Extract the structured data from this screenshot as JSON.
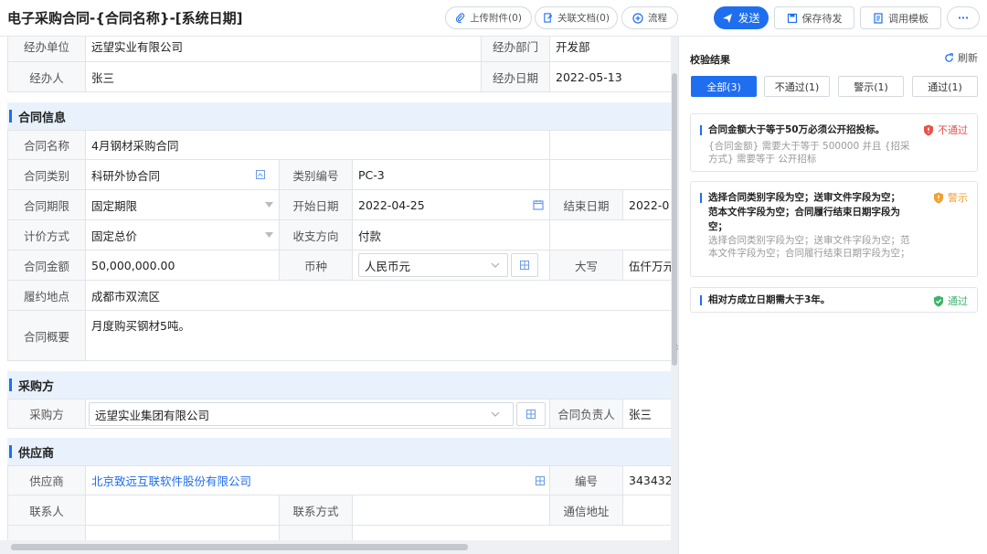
{
  "header": {
    "title": "电子采购合同-{合同名称}-[系统日期]",
    "upload_label": "上传附件(0)",
    "related_label": "关联文档(0)",
    "flow_label": "流程",
    "send_label": "发送",
    "save_label": "保存待发",
    "template_label": "调用模板",
    "more_label": "···"
  },
  "form": {
    "dept_unit_label": "经办单位",
    "dept_unit_value": "远望实业有限公司",
    "dept_label": "经办部门",
    "dept_value": "开发部",
    "handler_label": "经办人",
    "handler_value": "张三",
    "handle_date_label": "经办日期",
    "handle_date_value": "2022-05-13",
    "section_contract": "合同信息",
    "contract_name_label": "合同名称",
    "contract_name_value": "4月钢材采购合同",
    "category_label": "合同类别",
    "category_value": "科研外协合同",
    "category_code_label": "类别编号",
    "category_code_value": "PC-3",
    "period_label": "合同期限",
    "period_value": "固定期限",
    "start_date_label": "开始日期",
    "start_date_value": "2022-04-25",
    "end_date_label": "结束日期",
    "end_date_value": "2022-0",
    "pricing_label": "计价方式",
    "pricing_value": "固定总价",
    "direction_label": "收支方向",
    "direction_value": "付款",
    "amount_label": "合同金额",
    "amount_value": "50,000,000.00",
    "currency_label": "币种",
    "currency_value": "人民币元",
    "upper_label": "大写",
    "upper_value": "伍仟万元",
    "location_label": "履约地点",
    "location_value": "成都市双流区",
    "summary_label": "合同概要",
    "summary_value": "月度购买钢材5吨。",
    "section_buyer": "采购方",
    "buyer_label": "采购方",
    "buyer_value": "远望实业集团有限公司",
    "owner_label": "合同负责人",
    "owner_value": "张三",
    "section_supplier": "供应商",
    "supplier_label": "供应商",
    "supplier_value": "北京致远互联软件股份有限公司",
    "code_label": "编号",
    "code_value": "343432",
    "contact_label": "联系人",
    "contact_method_label": "联系方式",
    "address_label": "通信地址"
  },
  "panel": {
    "title": "校验结果",
    "refresh_label": "刷新",
    "tabs": [
      {
        "label": "全部(3)"
      },
      {
        "label": "不通过(1)"
      },
      {
        "label": "警示(1)"
      },
      {
        "label": "通过(1)"
      }
    ],
    "results": [
      {
        "title": "合同金额大于等于50万必须公开招投标。",
        "desc": "{合同金额} 需要大于等于 500000 并且 {招采方式} 需要等于 公开招标",
        "status": "不通过",
        "color": "#e5534b"
      },
      {
        "title": "选择合同类别字段为空；送审文件字段为空；范本文件字段为空；合同履行结束日期字段为空；",
        "desc": "选择合同类别字段为空；送审文件字段为空；范本文件字段为空；合同履行结束日期字段为空；",
        "status": "警示",
        "color": "#f0a030"
      },
      {
        "title": "相对方成立日期需大于3年。",
        "desc": "",
        "status": "通过",
        "color": "#3db36b"
      }
    ]
  },
  "colors": {
    "accent": "#1f6ef0",
    "section_bg": "#e9f2fc"
  }
}
